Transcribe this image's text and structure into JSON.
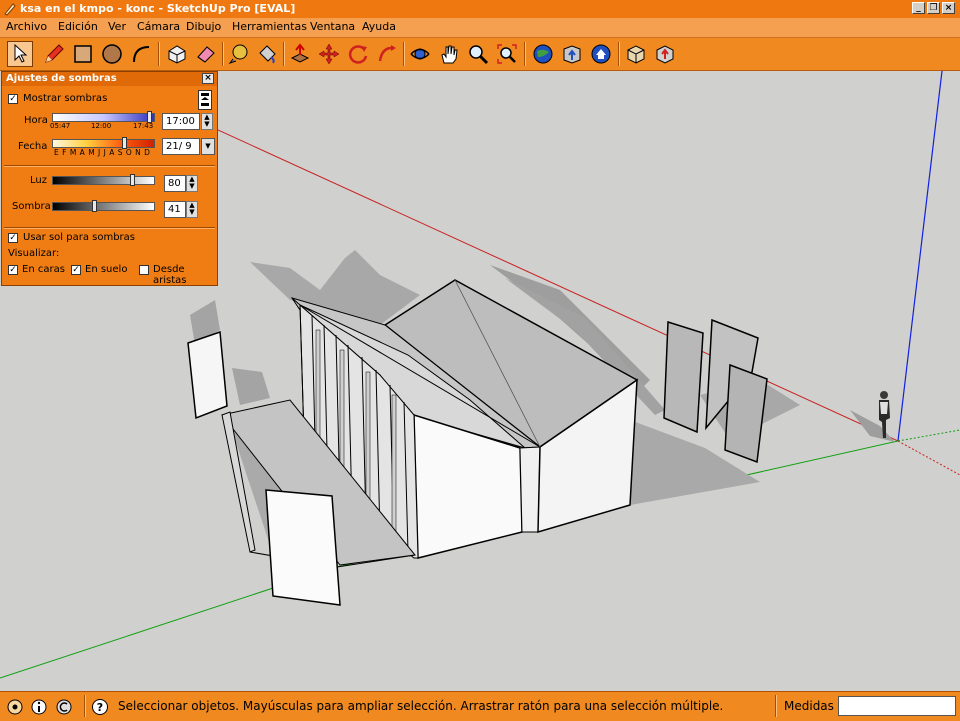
{
  "window": {
    "title": "ksa en el kmpo - konc - SketchUp Pro [EVAL]",
    "controls": [
      "_",
      "❐",
      "×"
    ]
  },
  "menu": [
    "Archivo",
    "Edición",
    "Ver",
    "Cámara",
    "Dibujo",
    "Herramientas",
    "Ventana",
    "Ayuda"
  ],
  "toolbar": {
    "tools": [
      "select-icon",
      "pencil-icon",
      "rectangle-icon",
      "circle-icon",
      "arc-icon",
      "make-component-icon",
      "eraser-icon",
      "tape-measure-icon",
      "paint-bucket-icon",
      "push-pull-icon",
      "move-icon",
      "rotate-icon",
      "follow-me-icon",
      "orbit-icon",
      "pan-icon",
      "zoom-icon",
      "zoom-extents-icon",
      "get-models-icon",
      "share-model-icon",
      "warehouse-icon",
      "components-icon",
      "share-component-icon"
    ]
  },
  "shadow_panel": {
    "title": "Ajustes de sombras",
    "close": "×",
    "show_shadows": {
      "label": "Mostrar sombras",
      "checked": true
    },
    "hour": {
      "label": "Hora",
      "value": "17:00",
      "tick_start": "05:47",
      "tick_mid": "12:00",
      "tick_end": "17:43",
      "level": 0.98
    },
    "date": {
      "label": "Fecha",
      "value": "21/ 9",
      "months": "E F M A M J J A S O N D",
      "level": 0.72
    },
    "light": {
      "label": "Luz",
      "value": "80",
      "level": 0.8
    },
    "shade": {
      "label": "Sombra",
      "value": "41",
      "level": 0.41
    },
    "use_sun": {
      "label": "Usar sol para sombras",
      "checked": true
    },
    "display_label": "Visualizar:",
    "on_faces": {
      "label": "En caras",
      "checked": true
    },
    "on_ground": {
      "label": "En suelo",
      "checked": true
    },
    "from_edges": {
      "label": "Desde aristas",
      "checked": false
    }
  },
  "statusbar": {
    "icons": [
      "geo-location-icon",
      "credits-icon",
      "sign-in-icon",
      "help-icon"
    ],
    "message": "Seleccionar objetos. Mayúsculas para ampliar selección. Arrastrar ratón para una selección múltiple.",
    "measures_label": "Medidas",
    "measures_value": ""
  },
  "colors": {
    "accent": "#f07d14",
    "titlebar": "#f07810",
    "menubar": "#f4a050",
    "viewport_bg": "#d0d0ce",
    "axis_red": "#c82020",
    "axis_green": "#10a010",
    "axis_blue": "#1020e0"
  }
}
